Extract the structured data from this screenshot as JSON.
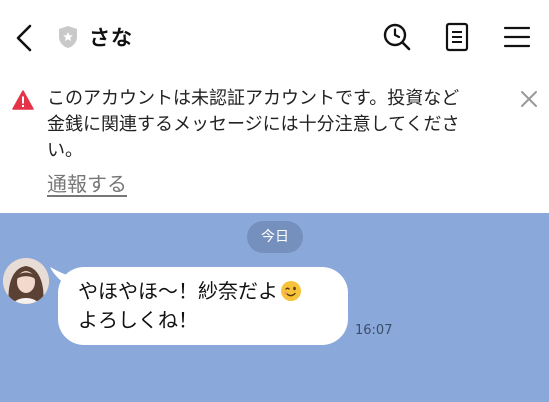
{
  "header": {
    "title": "さな"
  },
  "warning": {
    "text_line1": "このアカウントは未認証アカウントです。投資など",
    "text_line2": "金銭に関連するメッセージには十分注意してくださ",
    "text_line3": "い。",
    "report_link": "通報する"
  },
  "chat": {
    "date_label": "今日",
    "message": {
      "line1": "やほやほ〜！紗奈だよ",
      "line2": "よろしくね！",
      "emoji": "winking-face",
      "time": "16:07"
    }
  },
  "colors": {
    "chat_background": "#8aa8d9",
    "warning_icon": "#e4344a",
    "bubble": "#ffffff"
  },
  "icons": {
    "back": "chevron-left-icon",
    "verified_status": "shield-star-icon",
    "search": "search-icon",
    "notes": "note-icon",
    "menu": "hamburger-menu-icon",
    "warning": "warning-triangle-icon",
    "close": "close-icon"
  }
}
